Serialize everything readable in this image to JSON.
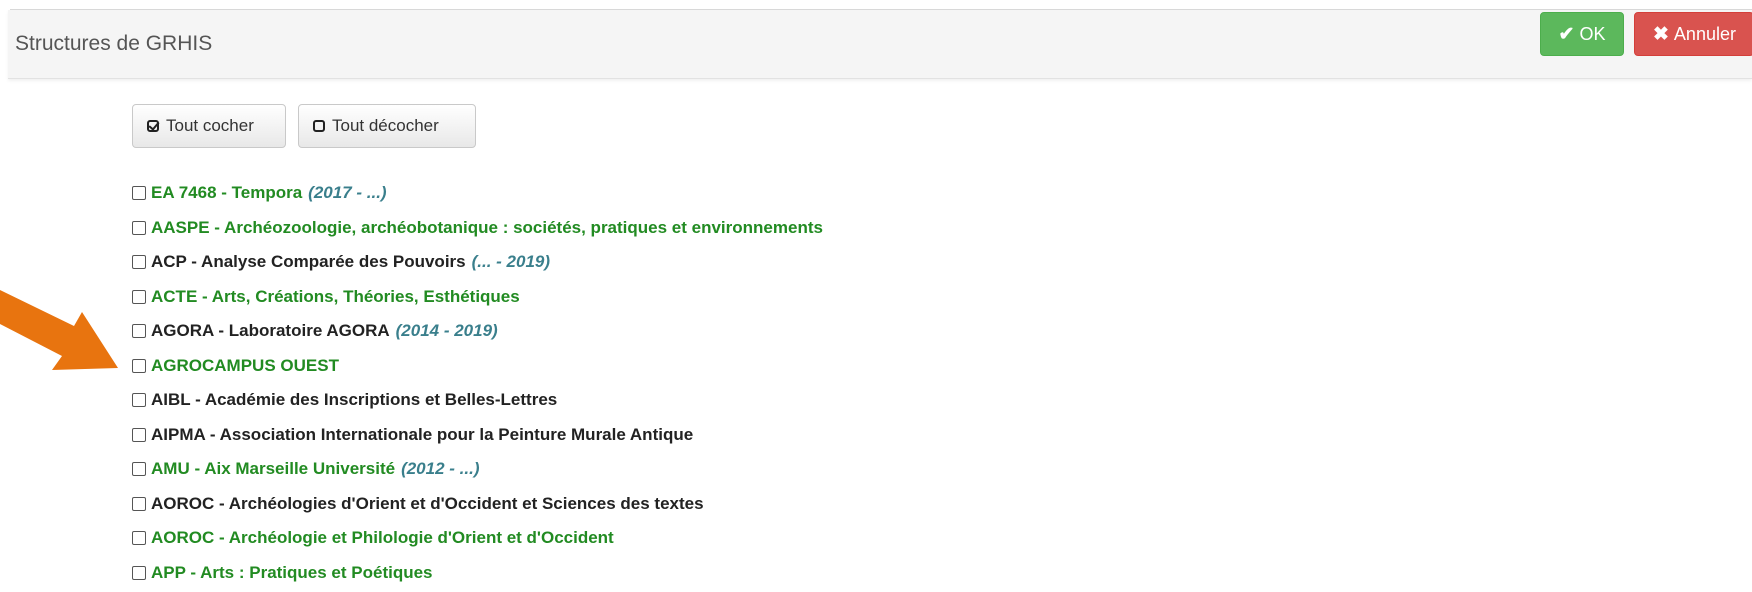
{
  "header": {
    "title": "Structures de GRHIS",
    "ok_label": "OK",
    "cancel_label": "Annuler"
  },
  "toolbar": {
    "check_all_label": "Tout cocher",
    "uncheck_all_label": "Tout décocher"
  },
  "items": [
    {
      "label": "EA 7468 - Tempora",
      "dates": "(2017 - ...)",
      "color": "#228b22"
    },
    {
      "label": "AASPE - Archéozoologie, archéobotanique : sociétés, pratiques et environnements",
      "dates": "",
      "color": "#228b22"
    },
    {
      "label": "ACP - Analyse Comparée des Pouvoirs",
      "dates": "(... - 2019)",
      "color": "#222222"
    },
    {
      "label": "ACTE - Arts, Créations, Théories, Esthétiques",
      "dates": "",
      "color": "#228b22"
    },
    {
      "label": "AGORA - Laboratoire AGORA",
      "dates": "(2014 - 2019)",
      "color": "#222222"
    },
    {
      "label": "AGROCAMPUS OUEST",
      "dates": "",
      "color": "#228b22"
    },
    {
      "label": "AIBL - Académie des Inscriptions et Belles-Lettres",
      "dates": "",
      "color": "#222222"
    },
    {
      "label": "AIPMA - Association Internationale pour la Peinture Murale Antique",
      "dates": "",
      "color": "#222222"
    },
    {
      "label": "AMU - Aix Marseille Université",
      "dates": "(2012 - ...)",
      "color": "#228b22"
    },
    {
      "label": "AOROC - Archéologies d'Orient et d'Occident et Sciences des textes",
      "dates": "",
      "color": "#222222"
    },
    {
      "label": "AOROC - Archéologie et Philologie d'Orient et d'Occident",
      "dates": "",
      "color": "#228b22"
    },
    {
      "label": "APP - Arts : Pratiques et Poétiques",
      "dates": "",
      "color": "#228b22"
    }
  ],
  "colors": {
    "ok_button": "#5cb85c",
    "cancel_button": "#d9534f",
    "green_item": "#228b22",
    "date_text": "#3a7f8c",
    "annotation_arrow": "#e8740f"
  }
}
